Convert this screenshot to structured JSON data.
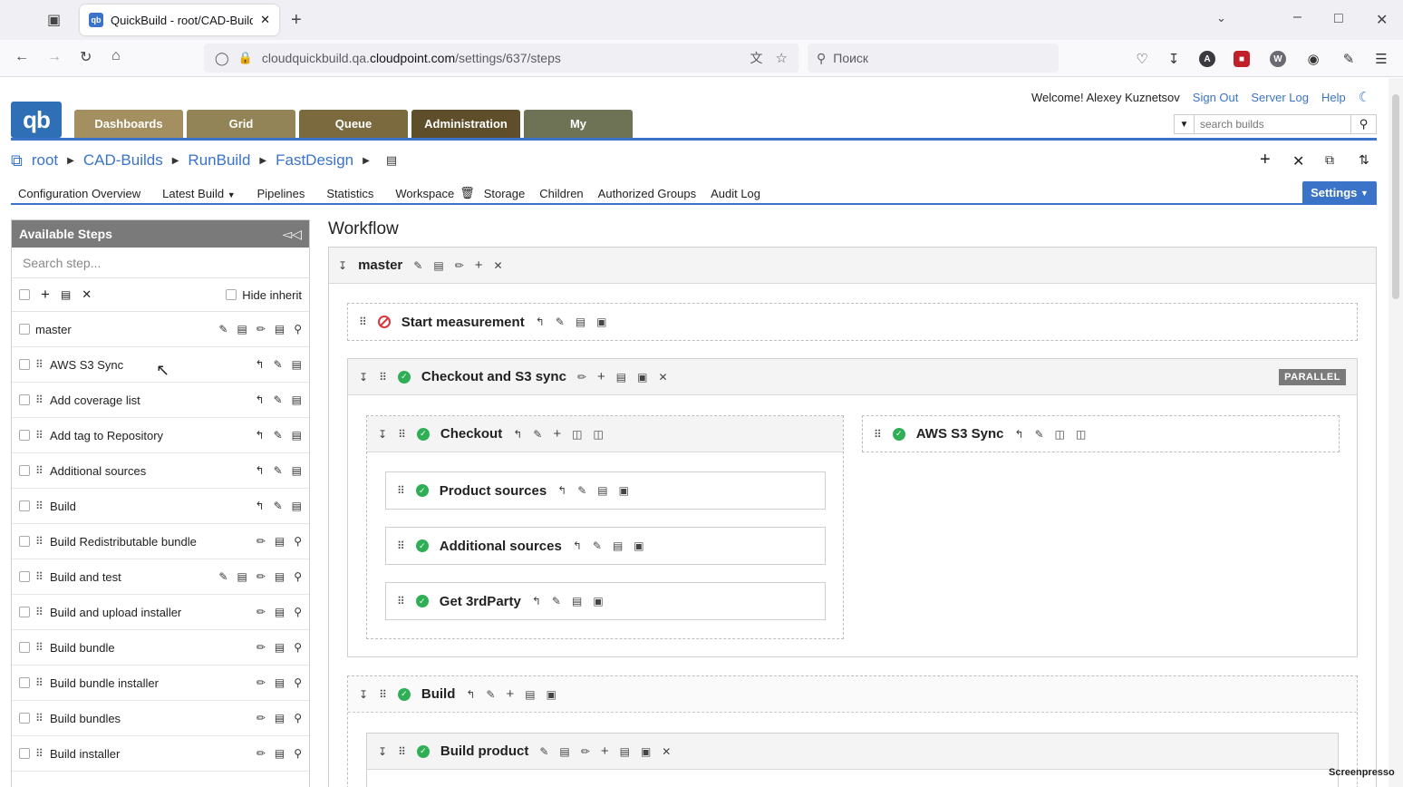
{
  "browser": {
    "tab_title": "QuickBuild - root/CAD-Builds/R",
    "url_prefix": "cloudquickbuild.qa.",
    "url_host": "cloudpoint.com",
    "url_path": "/settings/637/steps",
    "search_placeholder": "Поиск"
  },
  "header": {
    "logo": "qb",
    "nav_tabs": [
      {
        "label": "Dashboards",
        "color": "#a38f5f"
      },
      {
        "label": "Grid",
        "color": "#938457"
      },
      {
        "label": "Queue",
        "color": "#7a6a3e"
      },
      {
        "label": "Administration",
        "color": "#5e4e2a"
      },
      {
        "label": "My",
        "color": "#6e7355"
      }
    ],
    "welcome": "Welcome! Alexey Kuznetsov",
    "sign_out": "Sign Out",
    "server_log": "Server Log",
    "help": "Help",
    "search_placeholder": "search builds"
  },
  "breadcrumb": [
    "root",
    "CAD-Builds",
    "RunBuild",
    "FastDesign"
  ],
  "subnav": {
    "items": [
      "Configuration Overview",
      "Latest Build",
      "Pipelines",
      "Statistics",
      "Workspace",
      "Storage",
      "Children",
      "Authorized Groups",
      "Audit Log"
    ],
    "settings": "Settings"
  },
  "steps_panel": {
    "title": "Available Steps",
    "search_placeholder": "Search step...",
    "hide_inherit": "Hide inherit",
    "rows": [
      {
        "name": "master",
        "type": "composite"
      },
      {
        "name": "AWS S3 Sync",
        "type": "leaf"
      },
      {
        "name": "Add coverage list",
        "type": "leaf"
      },
      {
        "name": "Add tag to Repository",
        "type": "leaf"
      },
      {
        "name": "Additional sources",
        "type": "leaf"
      },
      {
        "name": "Build",
        "type": "leaf"
      },
      {
        "name": "Build Redistributable bundle",
        "type": "inherited"
      },
      {
        "name": "Build and test",
        "type": "inherited-composite"
      },
      {
        "name": "Build and upload installer",
        "type": "inherited"
      },
      {
        "name": "Build bundle",
        "type": "inherited"
      },
      {
        "name": "Build bundle installer",
        "type": "inherited"
      },
      {
        "name": "Build bundles",
        "type": "inherited"
      },
      {
        "name": "Build installer",
        "type": "inherited"
      }
    ]
  },
  "workflow": {
    "title": "Workflow",
    "root": "master",
    "start_measurement": "Start measurement",
    "checkout_s3": "Checkout and S3 sync",
    "parallel": "PARALLEL",
    "checkout": "Checkout",
    "checkout_children": [
      "Product sources",
      "Additional sources",
      "Get 3rdParty"
    ],
    "aws": "AWS S3 Sync",
    "build": "Build",
    "build_product": "Build product"
  },
  "watermark": "Screenpresso"
}
